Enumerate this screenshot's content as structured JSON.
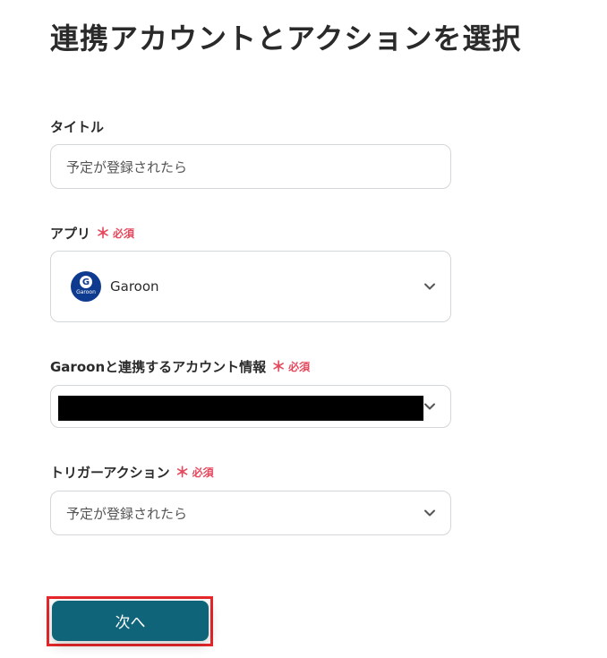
{
  "page_title": "連携アカウントとアクションを選択",
  "fields": {
    "title": {
      "label": "タイトル",
      "value": "予定が登録されたら"
    },
    "app": {
      "label": "アプリ",
      "required_label": "必須",
      "required_mark": "＊",
      "app_name": "Garoon",
      "logo_letter": "G",
      "logo_text": "Garoon"
    },
    "account": {
      "label": "Garoonと連携するアカウント情報",
      "required_label": "必須",
      "required_mark": "＊"
    },
    "trigger": {
      "label": "トリガーアクション",
      "required_label": "必須",
      "required_mark": "＊",
      "value": "予定が登録されたら"
    }
  },
  "next_button_label": "次へ",
  "colors": {
    "accent": "#0f6479",
    "required": "#e5475c",
    "highlight": "#e8272b",
    "garoon_blue": "#0e3a8f"
  }
}
